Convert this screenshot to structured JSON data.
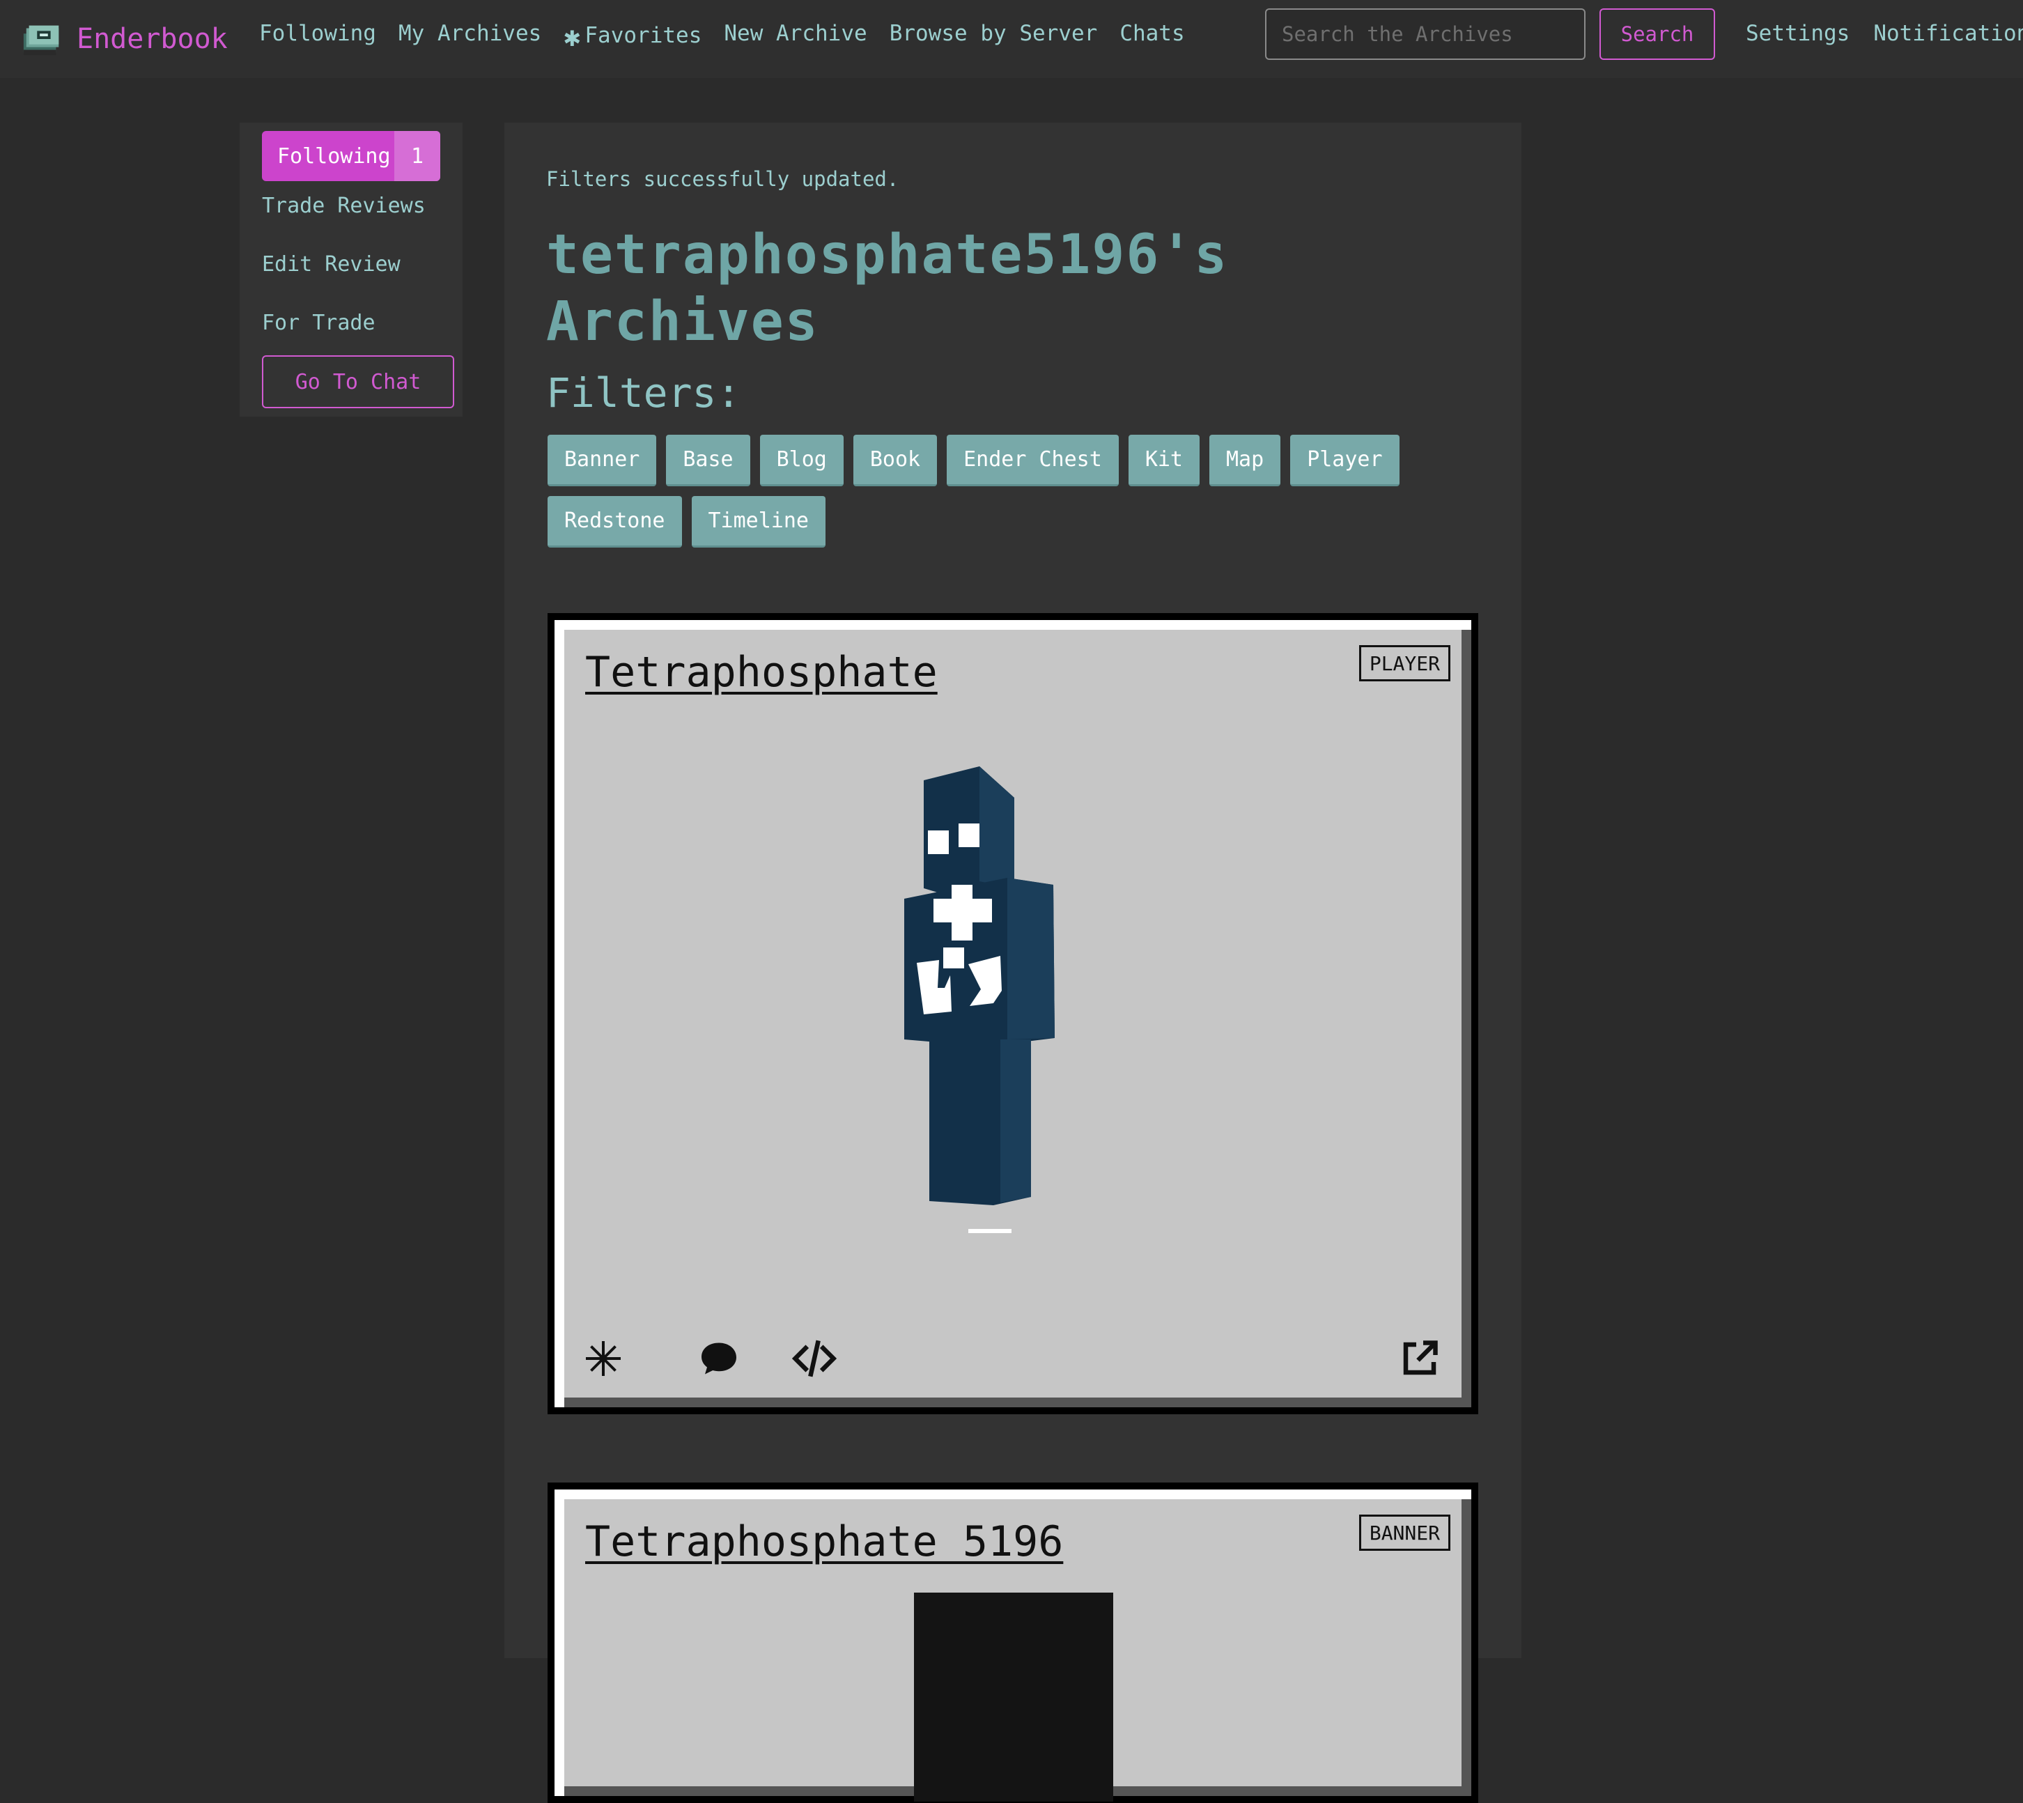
{
  "brand": {
    "name": "Enderbook"
  },
  "nav": {
    "following": "Following",
    "my_archives": "My Archives",
    "favorites": "Favorites",
    "new_archive": "New Archive",
    "browse_by_server": "Browse by Server",
    "chats": "Chats"
  },
  "search": {
    "placeholder": "Search the Archives",
    "button": "Search"
  },
  "right_nav": {
    "settings": "Settings",
    "notifications": "Notifications"
  },
  "sidebar": {
    "following_label": "Following",
    "following_count": "1",
    "trade_reviews": "Trade Reviews",
    "edit_review": "Edit Review",
    "for_trade": "For Trade",
    "go_to_chat": "Go To Chat"
  },
  "main": {
    "flash": "Filters successfully updated.",
    "title": "tetraphosphate5196's Archives",
    "filters_label": "Filters:",
    "filters": [
      "Banner",
      "Base",
      "Blog",
      "Book",
      "Ender Chest",
      "Kit",
      "Map",
      "Player",
      "Redstone",
      "Timeline"
    ]
  },
  "cards": [
    {
      "title": "Tetraphosphate",
      "badge": "PLAYER"
    },
    {
      "title": "Tetraphosphate 5196",
      "badge": "BANNER"
    }
  ],
  "colors": {
    "accent": "#d15ad1",
    "teal": "#9ccfcf",
    "skin": "#123049"
  },
  "icons": [
    "book-icon",
    "asterisk-icon",
    "favorite-icon",
    "comment-icon",
    "code-icon",
    "external-link-icon"
  ]
}
